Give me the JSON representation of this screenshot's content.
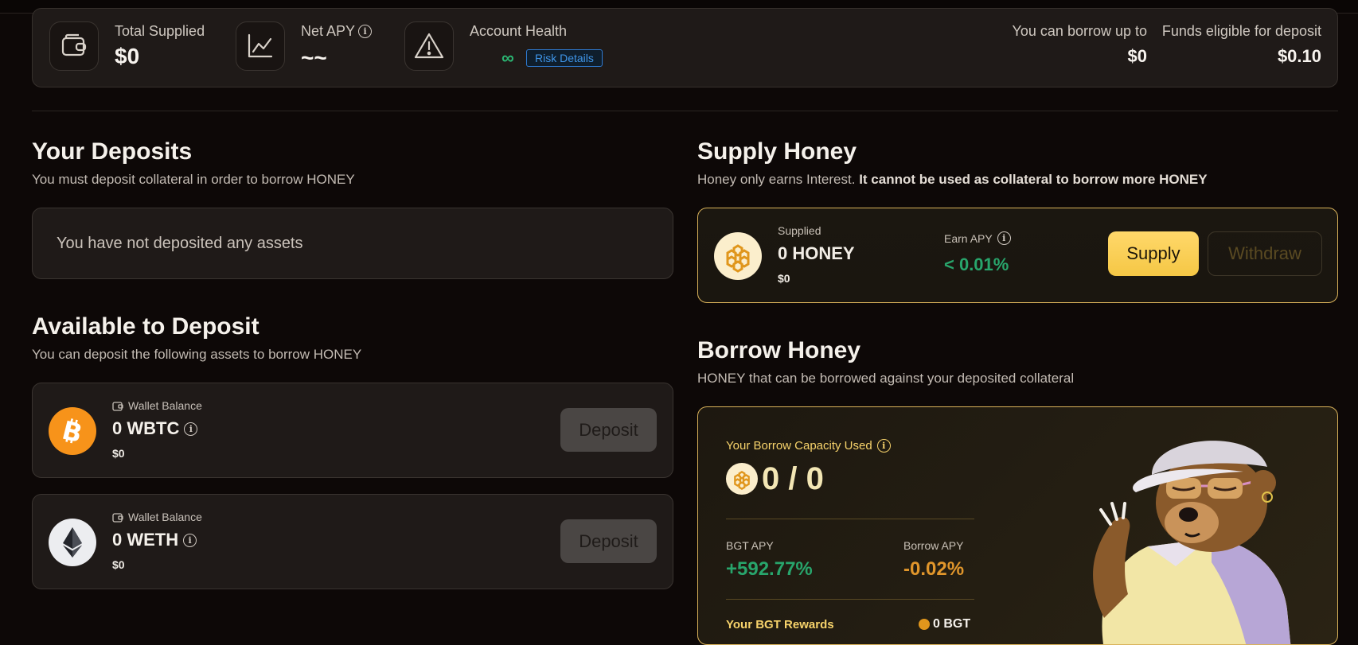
{
  "stats": {
    "total_supplied_label": "Total Supplied",
    "total_supplied_value": "$0",
    "net_apy_label": "Net APY",
    "net_apy_value": "~~",
    "account_health_label": "Account Health",
    "account_health_value": "∞",
    "risk_details_label": "Risk Details",
    "borrow_up_to_label": "You can borrow up to",
    "borrow_up_to_value": "$0",
    "funds_eligible_label": "Funds eligible for deposit",
    "funds_eligible_value": "$0.10"
  },
  "deposits": {
    "title": "Your Deposits",
    "subtitle": "You must deposit collateral in order to borrow HONEY",
    "empty_text": "You have not deposited any assets"
  },
  "available": {
    "title": "Available to Deposit",
    "subtitle": "You can deposit the following assets to borrow HONEY",
    "assets": [
      {
        "icon": "bitcoin-icon",
        "wallet_label": "Wallet Balance",
        "amount": "0 WBTC",
        "usd": "$0",
        "button": "Deposit"
      },
      {
        "icon": "ethereum-icon",
        "wallet_label": "Wallet Balance",
        "amount": "0 WETH",
        "usd": "$0",
        "button": "Deposit"
      }
    ]
  },
  "supply": {
    "title": "Supply Honey",
    "subtitle_plain": "Honey only earns Interest.",
    "subtitle_bold": "It cannot be used as collateral to borrow more HONEY",
    "supplied_label": "Supplied",
    "supplied_amount": "0 HONEY",
    "supplied_usd": "$0",
    "earn_apy_label": "Earn APY",
    "earn_apy_value": "< 0.01%",
    "supply_button": "Supply",
    "withdraw_button": "Withdraw"
  },
  "borrow": {
    "title": "Borrow Honey",
    "subtitle": "HONEY that can be borrowed against your deposited collateral",
    "capacity_label": "Your Borrow Capacity Used",
    "capacity_value": "0 / 0",
    "bgt_apy_label": "BGT APY",
    "bgt_apy_value": "+592.77%",
    "borrow_apy_label": "Borrow APY",
    "borrow_apy_value": "-0.02%",
    "rewards_label": "Your BGT Rewards",
    "rewards_value": "0 BGT"
  },
  "colors": {
    "accent_gold": "#f5c745",
    "positive_green": "#28a56c",
    "negative_orange": "#e1962b",
    "risk_blue": "#3f95e8"
  }
}
